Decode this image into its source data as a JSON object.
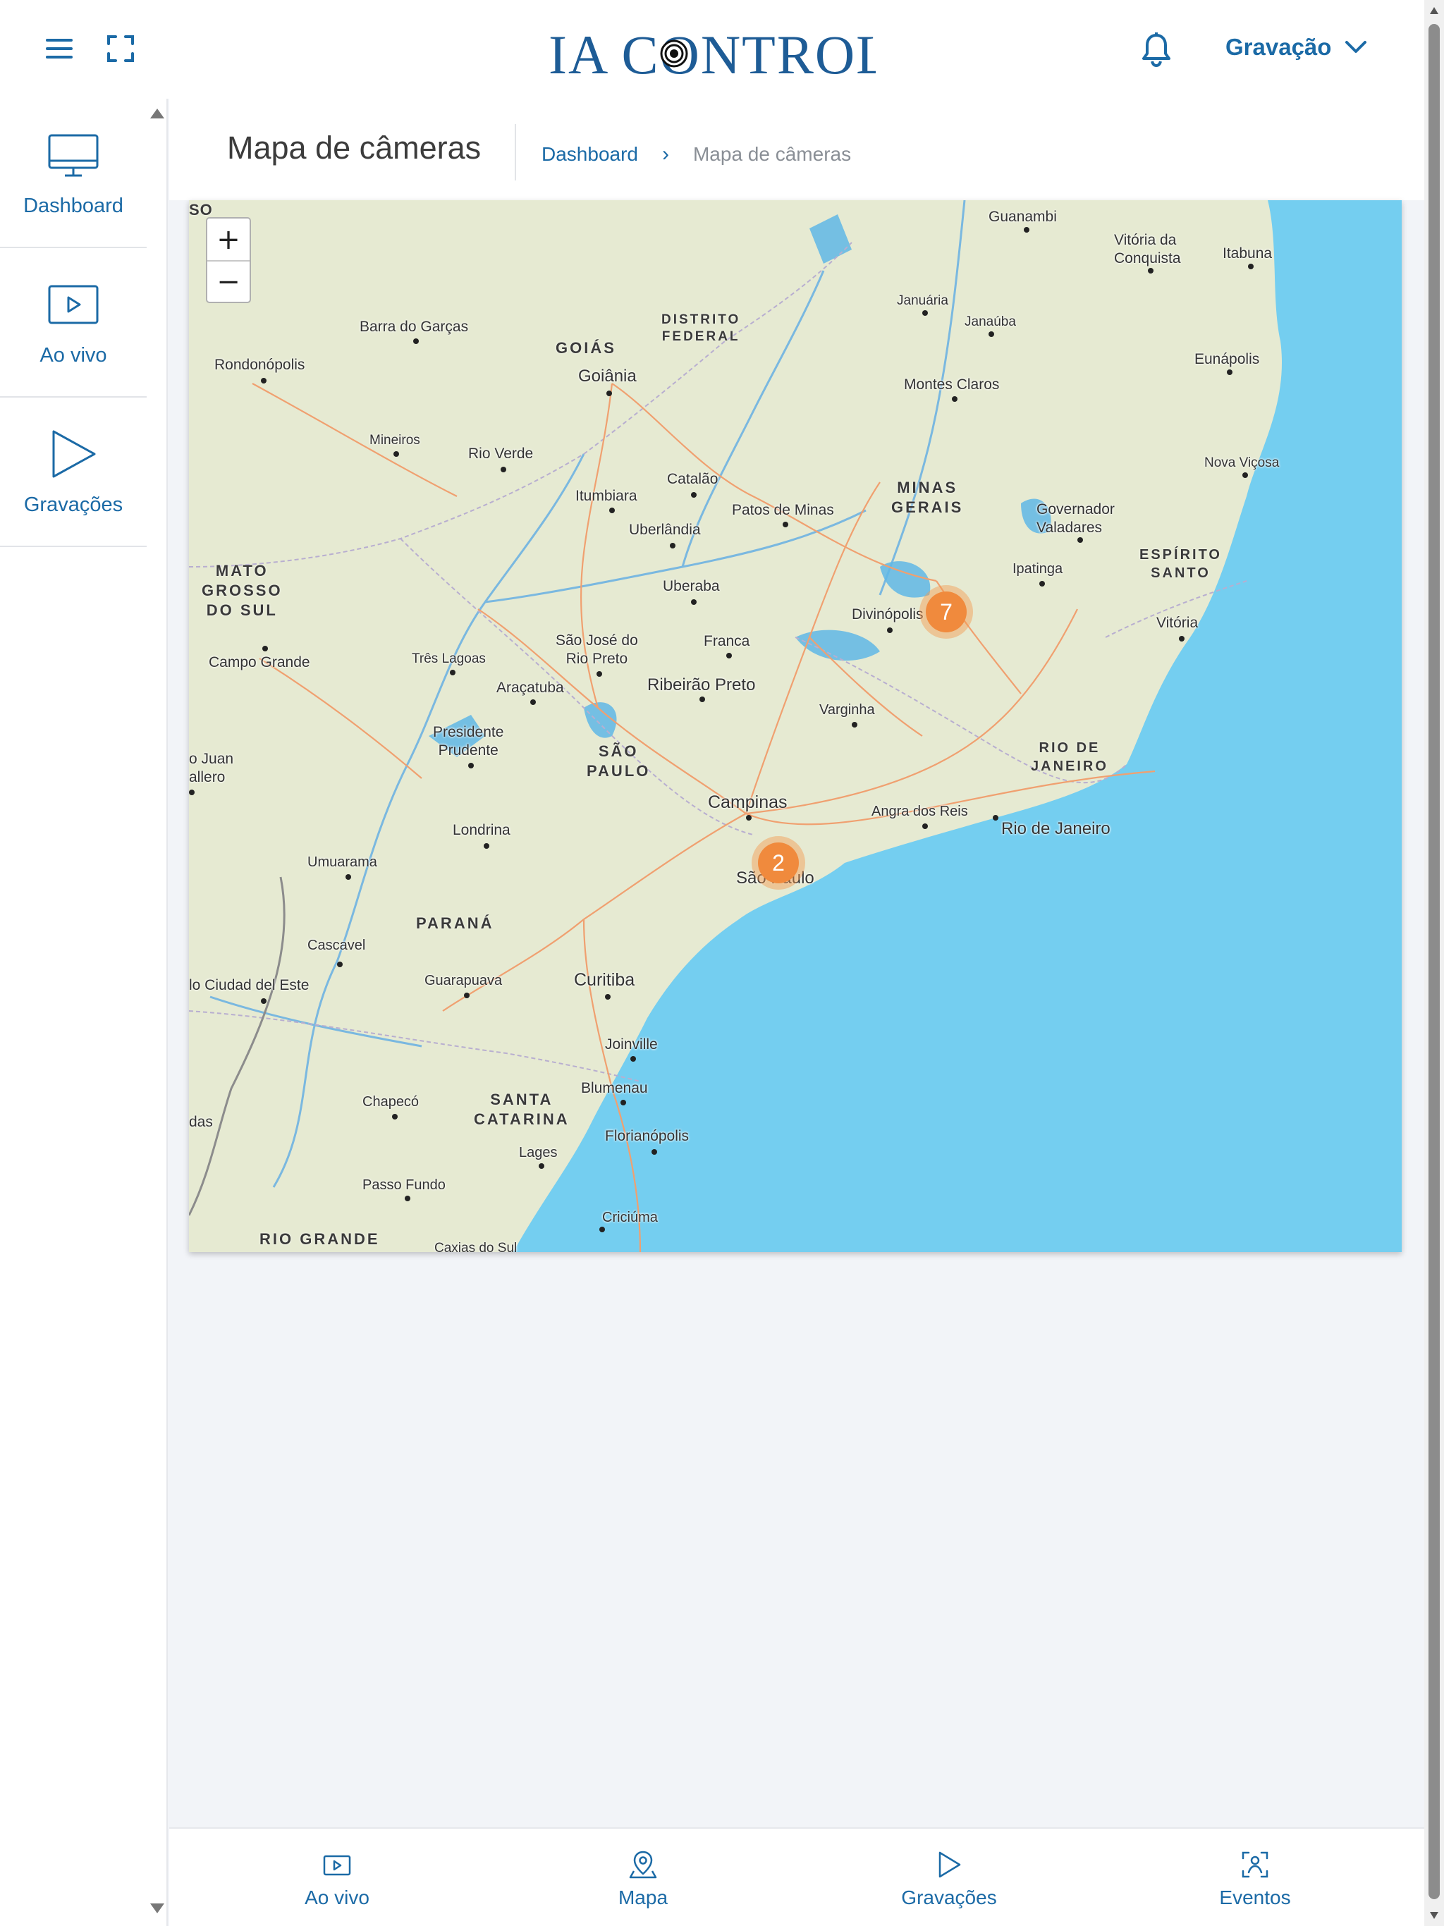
{
  "brand": {
    "logo_text": "IA CONTROL",
    "accent": "#1b6aa6",
    "cluster_color": "#f08a3d"
  },
  "header": {
    "user_menu_label": "Gravação",
    "icons": [
      "menu-icon",
      "fullscreen-icon",
      "bell-icon",
      "chevron-down-icon"
    ]
  },
  "sidebar": {
    "items": [
      {
        "label": "Dashboard",
        "icon": "monitor-icon"
      },
      {
        "label": "Ao vivo",
        "icon": "play-square-icon"
      },
      {
        "label": "Gravações",
        "icon": "play-icon"
      }
    ]
  },
  "page": {
    "title": "Mapa de câmeras",
    "breadcrumb": {
      "root": "Dashboard",
      "separator": "›",
      "current": "Mapa de câmeras"
    }
  },
  "map": {
    "zoom_in": "+",
    "zoom_out": "−",
    "clusters": [
      {
        "count": "7"
      },
      {
        "count": "2"
      }
    ],
    "regions": {
      "goias": "GOIÁS",
      "df": "DISTRITO\nFEDERAL",
      "mg": "MINAS\nGERAIS",
      "ms": "MATO\nGROSSO\nDO SUL",
      "es": "ESPÍRITO\nSANTO",
      "sp": "SÃO\nPAULO",
      "rj": "RIO DE\nJANEIRO",
      "pr": "PARANÁ",
      "sc": "SANTA\nCATARINA",
      "rs": "RIO GRANDE",
      "edge_so": "SO"
    },
    "places": {
      "guanambi": "Guanambi",
      "vitoria_conquista": "Vitória da\nConquista",
      "itabuna": "Itabuna",
      "januaria": "Januária",
      "janauba": "Janaúba",
      "eunapolis": "Eunápolis",
      "barra_garcas": "Barra do Garças",
      "rondonopolis": "Rondonópolis",
      "goiania": "Goiânia",
      "montes_claros": "Montes Claros",
      "mineiros": "Mineiros",
      "rio_verde": "Rio Verde",
      "nova_vicosa": "Nova Viçosa",
      "catalao": "Catalão",
      "itumbiara": "Itumbiara",
      "patos_minas": "Patos de Minas",
      "uberlandia": "Uberlândia",
      "governador_valadares": "Governador\nValadares",
      "ipatinga": "Ipatinga",
      "uberaba": "Uberaba",
      "divinopolis": "Divinópolis",
      "vitoria": "Vitória",
      "campo_grande": "Campo Grande",
      "tres_lagoas": "Três Lagoas",
      "sjrp": "São José do\nRio Preto",
      "franca": "Franca",
      "aracatuba": "Araçatuba",
      "ribeirao_preto": "Ribeirão Preto",
      "varginha": "Varginha",
      "presidente_prudente": "Presidente\nPrudente",
      "pedro_juan": "o Juan\nallero",
      "campinas": "Campinas",
      "angra": "Angra dos Reis",
      "rio_janeiro": "Rio de Janeiro",
      "londrina": "Londrina",
      "sao_paulo": "São Paulo",
      "umuarama": "Umuarama",
      "cascavel": "Cascavel",
      "ciudad_este": "lo Ciudad del Este",
      "guarapuava": "Guarapuava",
      "curitiba": "Curitiba",
      "joinville": "Joinville",
      "blumenau": "Blumenau",
      "chapeco": "Chapecó",
      "das": "das",
      "florianopolis": "Florianópolis",
      "lages": "Lages",
      "passo_fundo": "Passo Fundo",
      "criciuma": "Criciúma",
      "caxias": "Caxias do Sul"
    }
  },
  "bottom_nav": {
    "items": [
      {
        "label": "Ao vivo",
        "icon": "play-square-icon"
      },
      {
        "label": "Mapa",
        "icon": "map-pin-icon"
      },
      {
        "label": "Gravações",
        "icon": "play-icon"
      },
      {
        "label": "Eventos",
        "icon": "face-scan-icon"
      }
    ]
  }
}
